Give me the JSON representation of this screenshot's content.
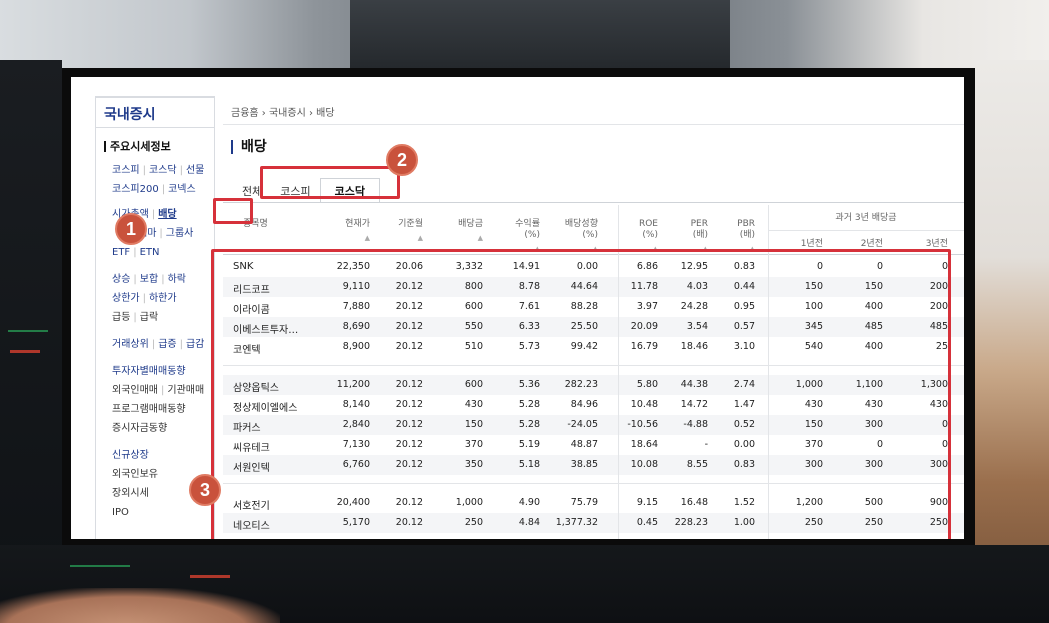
{
  "sidebar": {
    "title": "국내증시",
    "section1": "주요시세정보",
    "row1": [
      "코스피",
      "코스닥",
      "선물"
    ],
    "row2": [
      "코스피200",
      "코넥스"
    ],
    "row3": [
      "시가총액",
      "배당"
    ],
    "row4": [
      "ETF",
      "ETN"
    ],
    "row4b": [
      "테마",
      "그룹사"
    ],
    "row5": [
      "상승",
      "보합",
      "하락"
    ],
    "row6": [
      "상한가",
      "하한가"
    ],
    "row7": [
      "급등",
      "급락"
    ],
    "row8": [
      "거래상위",
      "급증",
      "급감"
    ],
    "row9": "투자자별매매동향",
    "row10": [
      "외국인매매",
      "기관매매"
    ],
    "row11": "프로그램매매동향",
    "row12": "증시자금동향",
    "row13": "신규상장",
    "row14": "외국인보유",
    "row15": "장외시세",
    "row16": "IPO"
  },
  "breadcrumb": [
    "금융홈",
    "국내증시",
    "배당"
  ],
  "page_title": "배당",
  "tabs": [
    "전체",
    "코스피",
    "코스닥"
  ],
  "selected_tab": "코스닥",
  "columns": {
    "name": "종목명",
    "price": "현재가",
    "base_month": "기준월",
    "dividend": "배당금",
    "yield": "수익률\n(%)",
    "payout": "배당성향\n(%)",
    "roe": "ROE\n(%)",
    "per": "PER\n(배)",
    "pbr": "PBR\n(배)",
    "past_group": "과거 3년 배당금",
    "y1": "1년전",
    "y2": "2년전",
    "y3": "3년전"
  },
  "rows": [
    [
      "SNK",
      "22,350",
      "20.06",
      "3,332",
      "14.91",
      "0.00",
      "6.86",
      "12.95",
      "0.83",
      "0",
      "0",
      "0"
    ],
    [
      "리드코프",
      "9,110",
      "20.12",
      "800",
      "8.78",
      "44.64",
      "11.78",
      "4.03",
      "0.44",
      "150",
      "150",
      "200"
    ],
    [
      "이라이콤",
      "7,880",
      "20.12",
      "600",
      "7.61",
      "88.28",
      "3.97",
      "24.28",
      "0.95",
      "100",
      "400",
      "200"
    ],
    [
      "이베스트투자…",
      "8,690",
      "20.12",
      "550",
      "6.33",
      "25.50",
      "20.09",
      "3.54",
      "0.57",
      "345",
      "485",
      "485"
    ],
    [
      "코엔텍",
      "8,900",
      "20.12",
      "510",
      "5.73",
      "99.42",
      "16.79",
      "18.46",
      "3.10",
      "540",
      "400",
      "25"
    ],
    [
      "삼양옵틱스",
      "11,200",
      "20.12",
      "600",
      "5.36",
      "282.23",
      "5.80",
      "44.38",
      "2.74",
      "1,000",
      "1,100",
      "1,300"
    ],
    [
      "정상제이엘에스",
      "8,140",
      "20.12",
      "430",
      "5.28",
      "84.96",
      "10.48",
      "14.72",
      "1.47",
      "430",
      "430",
      "430"
    ],
    [
      "파커스",
      "2,840",
      "20.12",
      "150",
      "5.28",
      "-24.05",
      "-10.56",
      "-4.88",
      "0.52",
      "150",
      "300",
      "0"
    ],
    [
      "씨유테크",
      "7,130",
      "20.12",
      "370",
      "5.19",
      "48.87",
      "18.64",
      "-",
      "0.00",
      "370",
      "0",
      "0"
    ],
    [
      "서원인텍",
      "6,760",
      "20.12",
      "350",
      "5.18",
      "38.85",
      "10.08",
      "8.55",
      "0.83",
      "300",
      "300",
      "300"
    ],
    [
      "서호전기",
      "20,400",
      "20.12",
      "1,000",
      "4.90",
      "75.79",
      "9.15",
      "16.48",
      "1.52",
      "1,200",
      "500",
      "900"
    ],
    [
      "네오티스",
      "5,170",
      "20.12",
      "250",
      "4.84",
      "1,377.32",
      "0.45",
      "228.23",
      "1.00",
      "250",
      "250",
      "250"
    ]
  ],
  "annotations": [
    "1",
    "2",
    "3"
  ],
  "colors": {
    "accent": "#1e3a8a",
    "highlight": "#d6313a",
    "badge": "#c9523c"
  }
}
